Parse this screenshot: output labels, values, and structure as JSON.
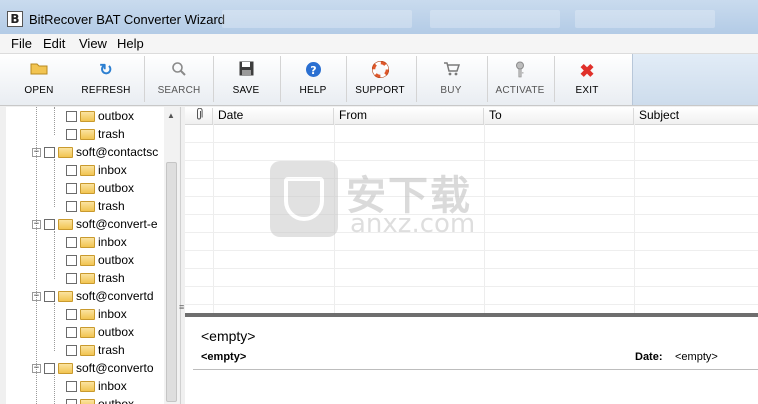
{
  "window": {
    "icon_letter": "B",
    "title": "BitRecover BAT Converter Wizard"
  },
  "menu": [
    "File",
    "Edit",
    "View",
    "Help"
  ],
  "toolbar": {
    "open": "OPEN",
    "refresh": "REFRESH",
    "search": "SEARCH",
    "save": "SAVE",
    "help": "HELP",
    "support": "SUPPORT",
    "buy": "BUY",
    "activate": "ACTIVATE",
    "exit": "EXIT"
  },
  "tree": {
    "items": [
      {
        "label": "outbox"
      },
      {
        "label": "trash"
      },
      {
        "label": "soft@contactsc"
      },
      {
        "label": "inbox"
      },
      {
        "label": "outbox"
      },
      {
        "label": "trash"
      },
      {
        "label": "soft@convert-e"
      },
      {
        "label": "inbox"
      },
      {
        "label": "outbox"
      },
      {
        "label": "trash"
      },
      {
        "label": "soft@convertd"
      },
      {
        "label": "inbox"
      },
      {
        "label": "outbox"
      },
      {
        "label": "trash"
      },
      {
        "label": "soft@converto"
      },
      {
        "label": "inbox"
      },
      {
        "label": "outbox"
      }
    ]
  },
  "grid": {
    "columns": [
      "Date",
      "From",
      "To",
      "Subject"
    ]
  },
  "watermark": {
    "chinese": "安下载",
    "domain": "anxz.com"
  },
  "preview": {
    "subject": "<empty>",
    "from": "<empty>",
    "date_label": "Date:",
    "date_value": "<empty>"
  },
  "colors": {
    "titlebar": "#c9dbee",
    "folder": "#f2c451",
    "preview_border": "#6e6e6e",
    "exit_red": "#e0302a",
    "refresh_blue": "#2c7fd1",
    "help_blue": "#2a6fd1"
  }
}
